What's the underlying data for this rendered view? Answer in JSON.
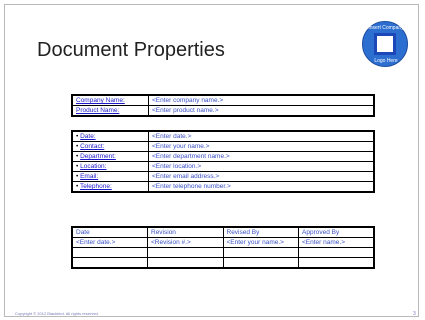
{
  "title": "Document Properties",
  "logo": {
    "top_text": "Insert Company",
    "bottom_text": "Logo Here"
  },
  "product_table": [
    {
      "label": "Company Name:",
      "value": "<Enter company name.>"
    },
    {
      "label": "Product Name:",
      "value": "<Enter product name.>"
    }
  ],
  "details_table": [
    {
      "label": "Date:",
      "value": "<Enter date.>"
    },
    {
      "label": "Contact:",
      "value": "<Enter your name.>"
    },
    {
      "label": "Department:",
      "value": "<Enter department name.>"
    },
    {
      "label": "Location:",
      "value": "<Enter location.>"
    },
    {
      "label": "Email:",
      "value": "<Enter email address.>"
    },
    {
      "label": "Telephone:",
      "value": "<Enter telephone number.>"
    }
  ],
  "revision_table": {
    "headers": [
      "Date",
      "Revision",
      "Revised By",
      "Approved By"
    ],
    "rows": [
      [
        "<Enter date.>",
        "<Revision #.>",
        "<Enter your name.>",
        "<Enter name.>"
      ],
      [
        "",
        "",
        "",
        ""
      ],
      [
        "",
        "",
        "",
        ""
      ]
    ]
  },
  "footer": "Copyright © 2012 Blackbird. All rights reserved.",
  "page_number": "3"
}
